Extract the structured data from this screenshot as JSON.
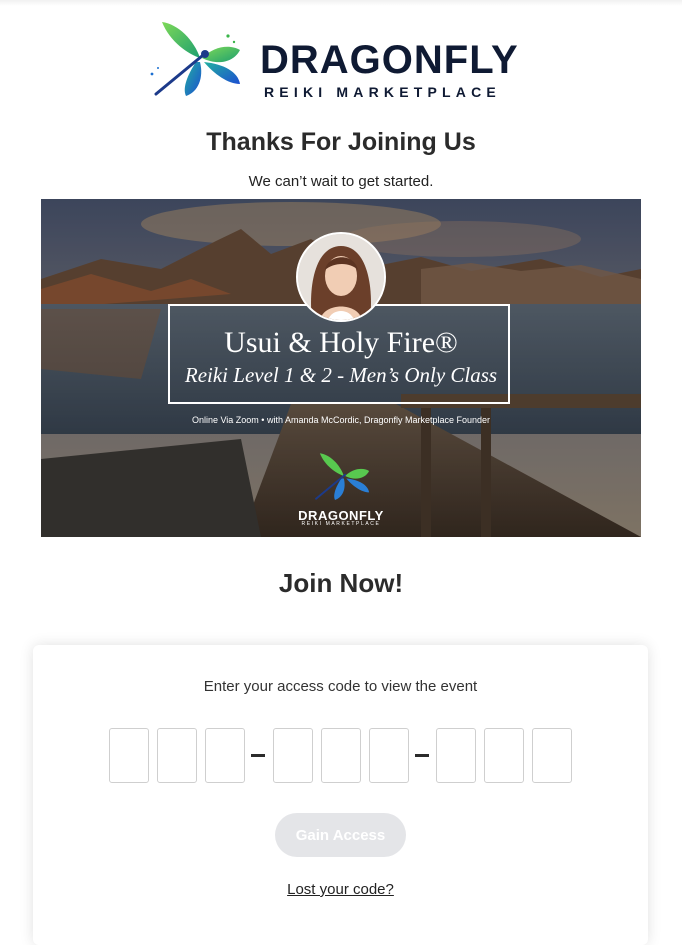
{
  "header": {
    "logo_word": "DRAGONFLY",
    "logo_sub": "REIKI MARKETPLACE",
    "logo_icon": "dragonfly-icon"
  },
  "thanks": {
    "title": "Thanks For Joining Us",
    "subtitle": "We can’t wait to get started."
  },
  "banner": {
    "title": "Usui & Holy Fire®",
    "subtitle": "Reiki Level 1 & 2 - Men’s Only Class",
    "caption": "Online Via Zoom • with Amanda McCordic, Dragonfly Marketplace Founder",
    "logo_word": "DRAGONFLY",
    "logo_sub": "REIKI MARKETPLACE"
  },
  "join": {
    "title": "Join Now!"
  },
  "access": {
    "label": "Enter your access code to view the event",
    "code_values": [
      "",
      "",
      "",
      "",
      "",
      "",
      "",
      "",
      ""
    ],
    "button_label": "Gain Access",
    "lost_link": "Lost your code?"
  },
  "colors": {
    "brand_navy": "#0f1a33",
    "brand_green": "#3ab54a",
    "brand_blue": "#1c6fd1",
    "button_disabled": "#e4e5e8"
  }
}
